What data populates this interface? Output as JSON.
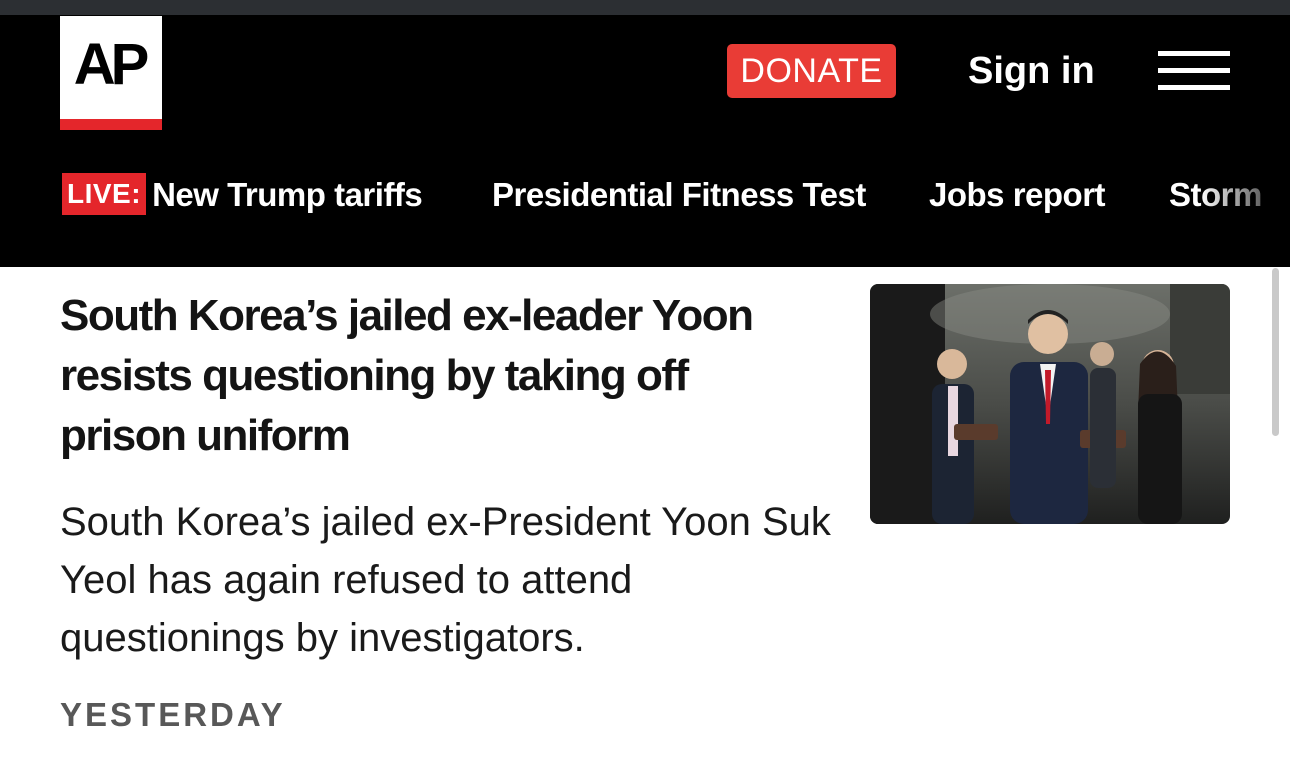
{
  "header": {
    "logo_text": "AP",
    "donate_label": "DONATE",
    "signin_label": "Sign in",
    "menu_icon": "hamburger-menu-icon"
  },
  "nav": {
    "live_badge": "LIVE:",
    "items": [
      {
        "label": "New Trump tariffs"
      },
      {
        "label": "Presidential Fitness Test"
      },
      {
        "label": "Jobs report"
      },
      {
        "label": "Storm"
      }
    ]
  },
  "article": {
    "headline": "South Korea’s jailed ex-leader Yoon resists questioning by taking off prison uniform",
    "summary": "South Korea’s jailed ex-President Yoon Suk Yeol has again refused to attend questionings by investigators.",
    "timestamp": "YESTERDAY"
  },
  "colors": {
    "header_bg": "#000000",
    "accent_red": "#e4262b",
    "donate_bg": "#e93c36",
    "text": "#141414",
    "timestamp": "#585858"
  }
}
